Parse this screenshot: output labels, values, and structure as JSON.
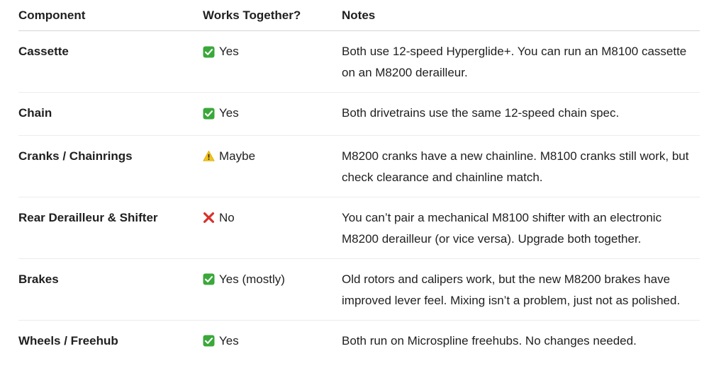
{
  "table": {
    "headers": [
      "Component",
      "Works Together?",
      "Notes"
    ],
    "rows": [
      {
        "component": "Cassette",
        "status_icon": "check-icon",
        "status": "Yes",
        "notes": "Both use 12-speed Hyperglide+. You can run an M8100 cassette on an M8200 derailleur."
      },
      {
        "component": "Chain",
        "status_icon": "check-icon",
        "status": "Yes",
        "notes": "Both drivetrains use the same 12-speed chain spec."
      },
      {
        "component": "Cranks / Chainrings",
        "status_icon": "warning-icon",
        "status": "Maybe",
        "notes": "M8200 cranks have a new chainline. M8100 cranks still work, but check clearance and chainline match."
      },
      {
        "component": "Rear Derailleur & Shifter",
        "status_icon": "cross-icon",
        "status": "No",
        "notes": "You can’t pair a mechanical M8100 shifter with an electronic M8200 derailleur (or vice versa). Upgrade both together."
      },
      {
        "component": "Brakes",
        "status_icon": "check-icon",
        "status": "Yes (mostly)",
        "notes": "Old rotors and calipers work, but the new M8200 brakes have improved lever feel. Mixing isn’t a problem, just not as polished."
      },
      {
        "component": "Wheels / Freehub",
        "status_icon": "check-icon",
        "status": "Yes",
        "notes": "Both run on Microspline freehubs. No changes needed."
      }
    ]
  },
  "colors": {
    "check": "#3aa83a",
    "warning": "#f2c21a",
    "cross": "#d9302c"
  }
}
